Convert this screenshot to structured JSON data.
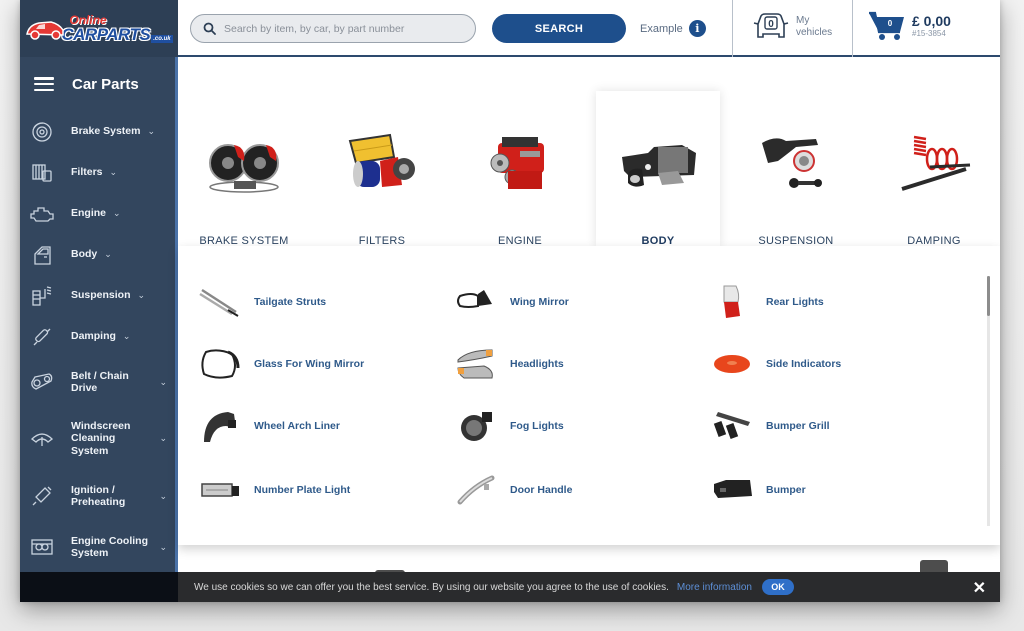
{
  "brand": {
    "online": "Online",
    "carparts": "CARPARTS",
    "tld": ".co.uk"
  },
  "header": {
    "search_placeholder": "Search by item, by car, by part number",
    "search_value": "",
    "search_button": "SEARCH",
    "example_label": "Example",
    "info_icon": "i",
    "vehicles_count": "0",
    "vehicles_label_1": "My",
    "vehicles_label_2": "vehicles",
    "cart_count": "0",
    "cart_total": "£ 0,00",
    "cart_ref": "#15-3854"
  },
  "sidebar": {
    "title": "Car Parts",
    "items": [
      {
        "label": "Brake System",
        "icon": "brake-disc-icon"
      },
      {
        "label": "Filters",
        "icon": "filter-icon"
      },
      {
        "label": "Engine",
        "icon": "engine-icon"
      },
      {
        "label": "Body",
        "icon": "car-door-icon"
      },
      {
        "label": "Suspension",
        "icon": "suspension-icon"
      },
      {
        "label": "Damping",
        "icon": "shock-absorber-icon"
      },
      {
        "label": "Belt / Chain Drive",
        "icon": "belt-drive-icon"
      },
      {
        "label": "Windscreen Cleaning System",
        "icon": "wiper-icon"
      },
      {
        "label": "Ignition / Preheating",
        "icon": "spark-plug-icon"
      },
      {
        "label": "Engine Cooling System",
        "icon": "radiator-icon"
      }
    ]
  },
  "categories": [
    {
      "label": "BRAKE SYSTEM",
      "active": false
    },
    {
      "label": "FILTERS",
      "active": false
    },
    {
      "label": "ENGINE",
      "active": false
    },
    {
      "label": "BODY",
      "active": true
    },
    {
      "label": "SUSPENSION",
      "active": false
    },
    {
      "label": "DAMPING",
      "active": false
    }
  ],
  "body_subcategories": [
    {
      "label": "Tailgate Struts"
    },
    {
      "label": "Wing Mirror"
    },
    {
      "label": "Rear Lights"
    },
    {
      "label": "Glass For Wing Mirror"
    },
    {
      "label": "Headlights"
    },
    {
      "label": "Side Indicators"
    },
    {
      "label": "Wheel Arch Liner"
    },
    {
      "label": "Fog Lights"
    },
    {
      "label": "Bumper Grill"
    },
    {
      "label": "Number Plate Light"
    },
    {
      "label": "Door Handle"
    },
    {
      "label": "Bumper"
    }
  ],
  "cookie": {
    "text": "We use cookies so we can offer you the best service. By using our website you agree to the use of cookies.",
    "link": "More information",
    "ok": "OK",
    "close": "✕"
  },
  "colors": {
    "primary": "#1e4f8c",
    "sidebar_bg": "#33465e",
    "link": "#2f5a8a",
    "brand_red": "#e53935"
  }
}
